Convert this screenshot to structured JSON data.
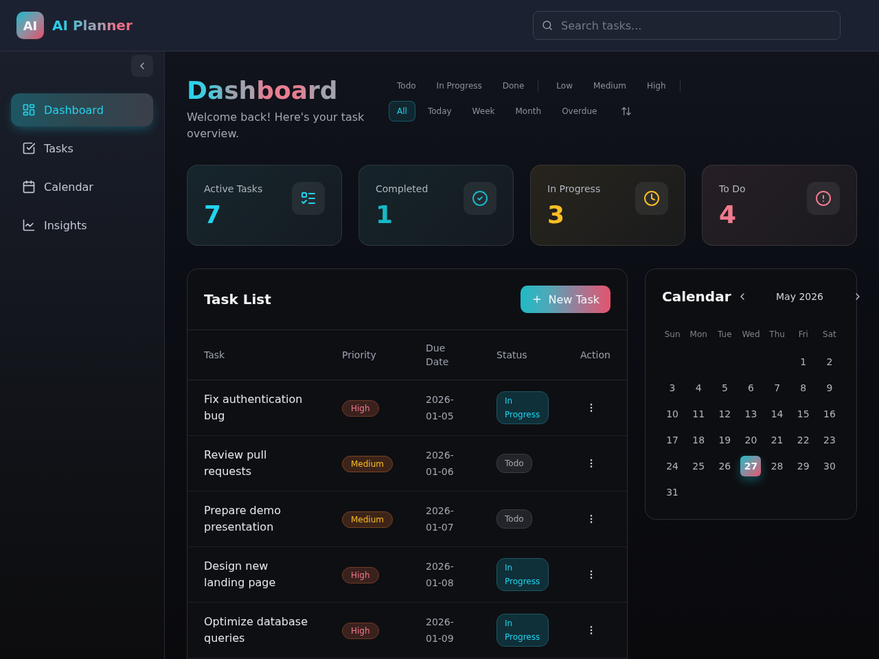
{
  "header": {
    "logo": "AI",
    "app_name": "AI Planner",
    "search": {
      "placeholder": "Search tasks..."
    }
  },
  "sidebar": {
    "items": [
      {
        "label": "Dashboard",
        "selected": true
      },
      {
        "label": "Tasks",
        "selected": false
      },
      {
        "label": "Calendar",
        "selected": false
      },
      {
        "label": "Insights",
        "selected": false
      }
    ]
  },
  "page": {
    "title": "Dashboard",
    "subtitle": "Welcome back! Here's your task overview."
  },
  "filters": {
    "status": [
      {
        "label": "Todo",
        "selected": false
      },
      {
        "label": "In Progress",
        "selected": false
      },
      {
        "label": "Done",
        "selected": false
      }
    ],
    "priority": [
      {
        "label": "Low",
        "selected": false
      },
      {
        "label": "Medium",
        "selected": false
      },
      {
        "label": "High",
        "selected": false
      }
    ],
    "period": [
      {
        "label": "All",
        "selected": true
      },
      {
        "label": "Today",
        "selected": false
      },
      {
        "label": "Week",
        "selected": false
      },
      {
        "label": "Month",
        "selected": false
      },
      {
        "label": "Overdue",
        "selected": false
      }
    ]
  },
  "stats": [
    {
      "label": "Active Tasks",
      "value": "7",
      "color": "#22d3ee"
    },
    {
      "label": "Completed",
      "value": "1",
      "color": "#16b8c8"
    },
    {
      "label": "In Progress",
      "value": "3",
      "color": "#fbbf24"
    },
    {
      "label": "To Do",
      "value": "4",
      "color": "#f07a8e"
    }
  ],
  "task_list": {
    "title": "Task List",
    "new_button": "New Task",
    "columns": [
      "Task",
      "Priority",
      "Due Date",
      "Status",
      "Action"
    ],
    "rows": [
      {
        "task": "Fix authentication bug",
        "priority": {
          "label": "High",
          "kind": "high"
        },
        "due": "2026-01-05",
        "status": {
          "label": "In Progress",
          "kind": "in_progress"
        }
      },
      {
        "task": "Review pull requests",
        "priority": {
          "label": "Medium",
          "kind": "medium"
        },
        "due": "2026-01-06",
        "status": {
          "label": "Todo",
          "kind": "todo"
        }
      },
      {
        "task": "Prepare demo presentation",
        "priority": {
          "label": "Medium",
          "kind": "medium"
        },
        "due": "2026-01-07",
        "status": {
          "label": "Todo",
          "kind": "todo"
        }
      },
      {
        "task": "Design new landing page",
        "priority": {
          "label": "High",
          "kind": "high"
        },
        "due": "2026-01-08",
        "status": {
          "label": "In Progress",
          "kind": "in_progress"
        }
      },
      {
        "task": "Optimize database queries",
        "priority": {
          "label": "High",
          "kind": "high"
        },
        "due": "2026-01-09",
        "status": {
          "label": "In Progress",
          "kind": "in_progress"
        }
      }
    ]
  },
  "calendar": {
    "title": "Calendar",
    "month": "May 2026",
    "weekdays": [
      "Sun",
      "Mon",
      "Tue",
      "Wed",
      "Thu",
      "Fri",
      "Sat"
    ],
    "weeks": [
      [
        {
          "label": "1",
          "selected": false
        },
        {
          "label": "2",
          "selected": false
        }
      ],
      [
        {
          "label": "3",
          "selected": false
        },
        {
          "label": "4",
          "selected": false
        },
        {
          "label": "5",
          "selected": false
        },
        {
          "label": "6",
          "selected": false
        },
        {
          "label": "7",
          "selected": false
        },
        {
          "label": "8",
          "selected": false
        },
        {
          "label": "9",
          "selected": false
        }
      ],
      [
        {
          "label": "10",
          "selected": false
        },
        {
          "label": "11",
          "selected": false
        },
        {
          "label": "12",
          "selected": false
        },
        {
          "label": "13",
          "selected": false
        },
        {
          "label": "14",
          "selected": false
        },
        {
          "label": "15",
          "selected": false
        },
        {
          "label": "16",
          "selected": false
        }
      ],
      [
        {
          "label": "17",
          "selected": false
        },
        {
          "label": "18",
          "selected": false
        },
        {
          "label": "19",
          "selected": false
        },
        {
          "label": "20",
          "selected": false
        },
        {
          "label": "21",
          "selected": false
        },
        {
          "label": "22",
          "selected": false
        },
        {
          "label": "23",
          "selected": false
        }
      ],
      [
        {
          "label": "24",
          "selected": false
        },
        {
          "label": "25",
          "selected": false
        },
        {
          "label": "26",
          "selected": false
        },
        {
          "label": "27",
          "selected": true
        },
        {
          "label": "28",
          "selected": false
        },
        {
          "label": "29",
          "selected": false
        },
        {
          "label": "30",
          "selected": false
        }
      ],
      [
        {
          "label": "31",
          "selected": false
        }
      ]
    ]
  }
}
